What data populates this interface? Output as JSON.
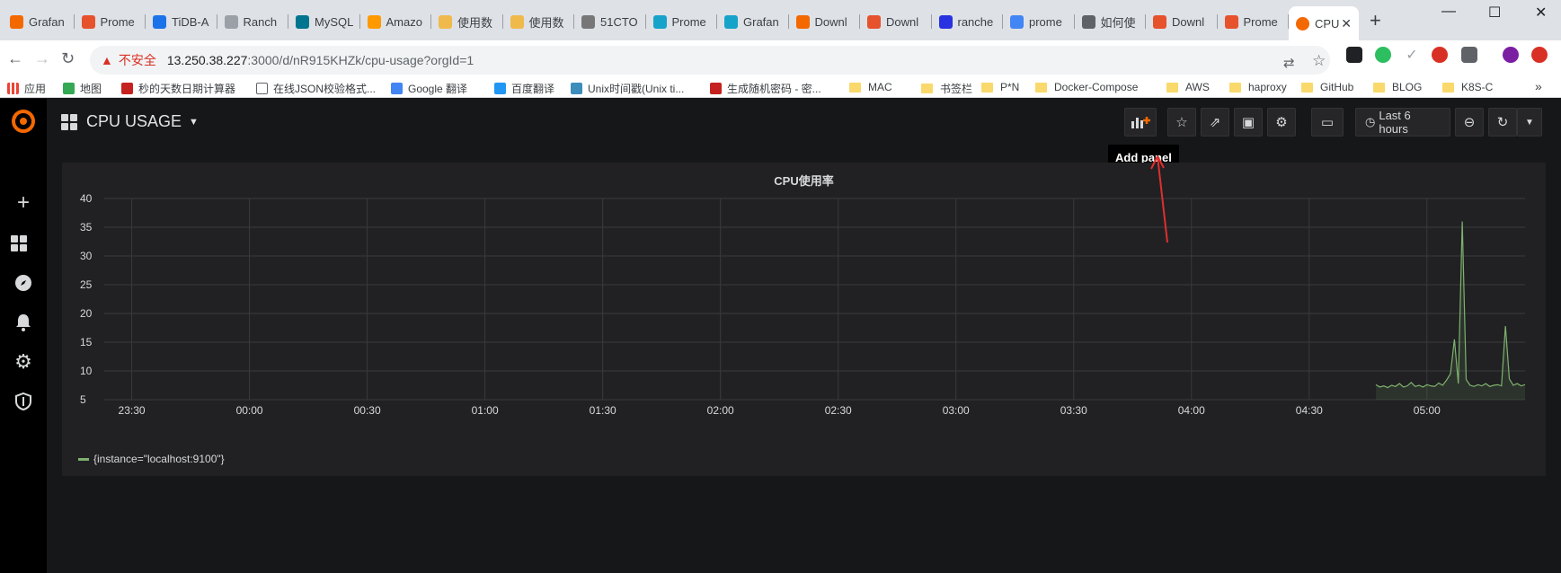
{
  "browser": {
    "tabs": [
      {
        "label": "Grafan",
        "fav_color": "#f46800"
      },
      {
        "label": "Prome",
        "fav_color": "#e6522c"
      },
      {
        "label": "TiDB-A",
        "fav_color": "#1a73e8"
      },
      {
        "label": "Ranch",
        "fav_color": "#9aa0a6"
      },
      {
        "label": "MySQL",
        "fav_color": "#00758f"
      },
      {
        "label": "Amazo",
        "fav_color": "#ff9900"
      },
      {
        "label": "使用数",
        "fav_color": "#f0b94b"
      },
      {
        "label": "使用数",
        "fav_color": "#f0b94b"
      },
      {
        "label": "51CTO",
        "fav_color": "#777777"
      },
      {
        "label": "Prome",
        "fav_color": "#16a3c9"
      },
      {
        "label": "Grafan",
        "fav_color": "#16a3c9"
      },
      {
        "label": "Downl",
        "fav_color": "#f46800"
      },
      {
        "label": "Downl",
        "fav_color": "#e6522c"
      },
      {
        "label": "ranche",
        "fav_color": "#2932e1"
      },
      {
        "label": "prome",
        "fav_color": "#4285f4"
      },
      {
        "label": "如何使",
        "fav_color": "#5f6368"
      },
      {
        "label": "Downl",
        "fav_color": "#e6522c"
      },
      {
        "label": "Prome",
        "fav_color": "#e6522c"
      }
    ],
    "active_tab": {
      "label": "CPU",
      "fav_color": "#f46800"
    },
    "new_tab": "+",
    "window_controls": {
      "minimize": "—",
      "maximize": "☐",
      "close": "✕"
    },
    "address": {
      "warning": "▲",
      "insecure": "不安全",
      "host": "13.250.38.227",
      "path": ":3000/d/nR915KHZk/cpu-usage?orgId=1"
    },
    "bookmarks": [
      {
        "label": "应用",
        "type": "apps"
      },
      {
        "label": "地图",
        "type": "site",
        "color": "#34a853"
      },
      {
        "label": "秒的天数日期计算器",
        "type": "site",
        "color": "#c5221f"
      },
      {
        "label": "在线JSON校验格式...",
        "type": "page"
      },
      {
        "label": "Google 翻译",
        "type": "site",
        "color": "#4285f4"
      },
      {
        "label": "百度翻译",
        "type": "site",
        "color": "#2196f3"
      },
      {
        "label": "Unix时间戳(Unix ti...",
        "type": "site",
        "color": "#3c8dbc"
      },
      {
        "label": "生成随机密码 - 密...",
        "type": "site",
        "color": "#c5221f"
      },
      {
        "label": "MAC",
        "type": "folder"
      },
      {
        "label": "书签栏",
        "type": "folder"
      },
      {
        "label": "P*N",
        "type": "folder"
      },
      {
        "label": "Docker-Compose",
        "type": "folder"
      },
      {
        "label": "AWS",
        "type": "folder"
      },
      {
        "label": "haproxy",
        "type": "folder"
      },
      {
        "label": "GitHub",
        "type": "folder"
      },
      {
        "label": "BLOG",
        "type": "folder"
      },
      {
        "label": "K8S-C",
        "type": "folder"
      }
    ],
    "more_bookmarks": "»"
  },
  "grafana": {
    "dashboard_title": "CPU USAGE",
    "time_range": "Last 6 hours",
    "tooltip": "Add panel",
    "panel": {
      "title": "CPU使用率",
      "legend": "{instance=\"localhost:9100\"}"
    },
    "colors": {
      "series": "#7eb26d",
      "logo": "#f46800",
      "annotation": "#e02f2f"
    }
  },
  "chart_data": {
    "type": "line",
    "title": "CPU使用率",
    "xlabel": "",
    "ylabel": "",
    "ylim": [
      5,
      40
    ],
    "yticks": [
      5,
      10,
      15,
      20,
      25,
      30,
      35,
      40
    ],
    "xticks": [
      "23:30",
      "00:00",
      "00:30",
      "01:00",
      "01:30",
      "02:00",
      "02:30",
      "03:00",
      "03:30",
      "04:00",
      "04:30",
      "05:00"
    ],
    "x_domain": [
      "23:23",
      "05:25"
    ],
    "grid": true,
    "legend": "bottom-left",
    "series": [
      {
        "name": "{instance=\"localhost:9100\"}",
        "color": "#7eb26d",
        "x": [
          "04:47",
          "04:48",
          "04:49",
          "04:50",
          "04:51",
          "04:52",
          "04:53",
          "04:54",
          "04:55",
          "04:56",
          "04:57",
          "04:58",
          "04:59",
          "05:00",
          "05:01",
          "05:02",
          "05:03",
          "05:04",
          "05:05",
          "05:06",
          "05:07",
          "05:08",
          "05:09",
          "05:10",
          "05:11",
          "05:12",
          "05:13",
          "05:14",
          "05:15",
          "05:16",
          "05:17",
          "05:18",
          "05:19",
          "05:20",
          "05:21",
          "05:22",
          "05:23",
          "05:24",
          "05:25"
        ],
        "y": [
          7.6,
          7.2,
          7.4,
          7.1,
          7.5,
          7.3,
          7.8,
          7.2,
          7.4,
          8.0,
          7.3,
          7.5,
          7.2,
          7.6,
          7.4,
          7.3,
          7.9,
          7.5,
          8.4,
          9.5,
          15.5,
          7.8,
          36.0,
          8.5,
          7.5,
          7.3,
          7.6,
          7.4,
          7.8,
          7.3,
          7.5,
          7.6,
          7.4,
          17.8,
          8.6,
          7.5,
          7.8,
          7.4,
          7.6
        ]
      }
    ]
  }
}
